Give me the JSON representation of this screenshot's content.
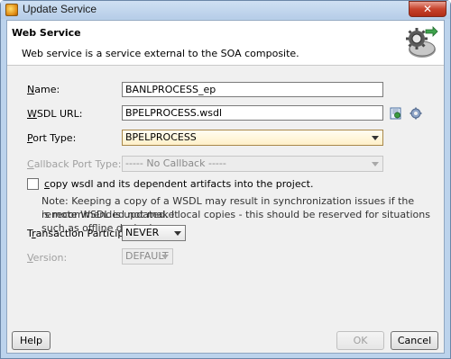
{
  "window": {
    "title": "Update Service",
    "close_glyph": "✕"
  },
  "header": {
    "title": "Web Service",
    "description": "Web service is a service external to the SOA composite.",
    "icon": "web-service-gear-icon"
  },
  "form": {
    "name_label_u": "N",
    "name_label_rest": "ame:",
    "name_value": "BANLPROCESS_ep",
    "wsdl_label_u": "W",
    "wsdl_label_rest": "SDL URL:",
    "wsdl_value": "BPELPROCESS.wsdl",
    "port_label_u": "P",
    "port_label_rest": "ort Type:",
    "port_value": "BPELPROCESS",
    "callback_label_u": "C",
    "callback_label_rest": "allback Port Type:",
    "callback_value": "----- No Callback -----",
    "copy_label_u": "c",
    "copy_label_rest": "opy wsdl and its dependent artifacts into the project.",
    "note_line1": "Note: Keeping a copy of a WSDL may result in synchronization issues if the remote WSDL is updated. It",
    "note_line2": "is recommended not make local copies - this should be reserved for situations such as offline designing.",
    "transaction_label_pre": "T",
    "transaction_label_u": "r",
    "transaction_label_rest": "ansaction Participation:",
    "transaction_value": "NEVER",
    "version_label_u": "V",
    "version_label_rest": "ersion:",
    "version_value": "DEFAULT"
  },
  "buttons": {
    "help": "Help",
    "ok": "OK",
    "cancel": "Cancel"
  }
}
